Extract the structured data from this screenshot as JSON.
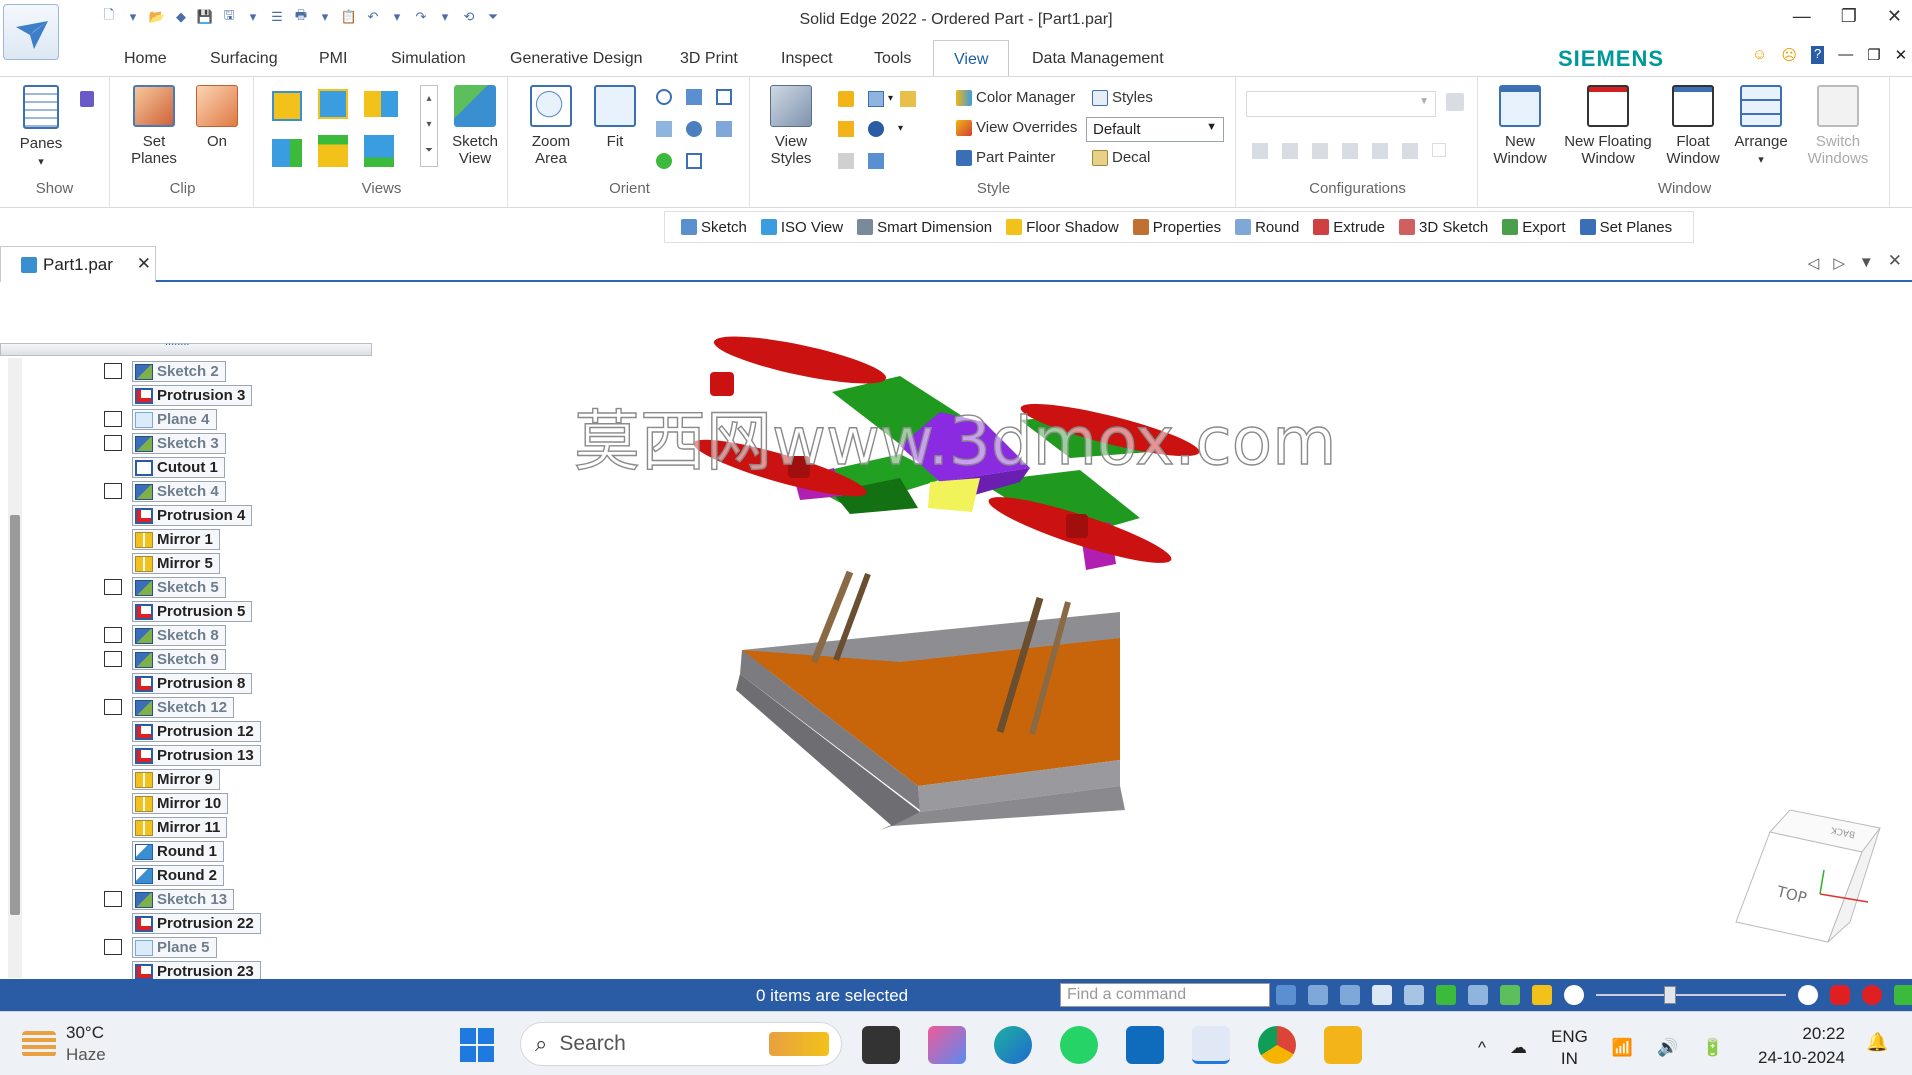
{
  "window": {
    "title": "Solid Edge 2022 - Ordered Part - [Part1.par]"
  },
  "tabs": [
    "Home",
    "Surfacing",
    "PMI",
    "Simulation",
    "Generative Design",
    "3D Print",
    "Inspect",
    "Tools",
    "View",
    "Data Management"
  ],
  "active_tab": "View",
  "brand": "SIEMENS",
  "ribbon": {
    "show": {
      "panes_label": "Panes",
      "group_label": "Show"
    },
    "clip": {
      "set_planes_label": "Set\nPlanes",
      "on_label": "On",
      "group_label": "Clip"
    },
    "views": {
      "sketch_view_label": "Sketch\nView",
      "group_label": "Views"
    },
    "orient": {
      "zoom_area_label": "Zoom\nArea",
      "fit_label": "Fit",
      "group_label": "Orient"
    },
    "style": {
      "view_styles_label": "View\nStyles",
      "color_manager": "Color Manager",
      "styles": "Styles",
      "view_overrides": "View Overrides",
      "overrides_value": "Default",
      "part_painter": "Part Painter",
      "decal": "Decal",
      "group_label": "Style"
    },
    "configurations": {
      "group_label": "Configurations"
    },
    "window": {
      "new_window": "New\nWindow",
      "new_floating_window": "New Floating\nWindow",
      "float_window": "Float\nWindow",
      "arrange": "Arrange",
      "switch_windows": "Switch\nWindows",
      "group_label": "Window"
    }
  },
  "command_bar": [
    "Sketch",
    "ISO View",
    "Smart Dimension",
    "Floor Shadow",
    "Properties",
    "Round",
    "Extrude",
    "3D Sketch",
    "Export",
    "Set Planes"
  ],
  "document_tab": {
    "label": "Part1.par"
  },
  "pathfinder": {
    "header_dots": "........",
    "items": [
      {
        "label": "Sketch 2",
        "type": "sketch",
        "check": true
      },
      {
        "label": "Protrusion 3",
        "type": "protrusion",
        "check": false
      },
      {
        "label": "Plane 4",
        "type": "plane",
        "check": true
      },
      {
        "label": "Sketch 3",
        "type": "sketch",
        "check": true
      },
      {
        "label": "Cutout 1",
        "type": "cutout",
        "check": false
      },
      {
        "label": "Sketch 4",
        "type": "sketch",
        "check": true
      },
      {
        "label": "Protrusion 4",
        "type": "protrusion",
        "check": false
      },
      {
        "label": "Mirror 1",
        "type": "mirror",
        "check": false
      },
      {
        "label": "Mirror 5",
        "type": "mirror",
        "check": false
      },
      {
        "label": "Sketch 5",
        "type": "sketch",
        "check": true
      },
      {
        "label": "Protrusion 5",
        "type": "protrusion",
        "check": false
      },
      {
        "label": "Sketch 8",
        "type": "sketch",
        "check": true
      },
      {
        "label": "Sketch 9",
        "type": "sketch",
        "check": true
      },
      {
        "label": "Protrusion 8",
        "type": "protrusion",
        "check": false
      },
      {
        "label": "Sketch 12",
        "type": "sketch",
        "check": true
      },
      {
        "label": "Protrusion 12",
        "type": "protrusion",
        "check": false
      },
      {
        "label": "Protrusion 13",
        "type": "protrusion",
        "check": false
      },
      {
        "label": "Mirror 9",
        "type": "mirror",
        "check": false
      },
      {
        "label": "Mirror 10",
        "type": "mirror",
        "check": false
      },
      {
        "label": "Mirror 11",
        "type": "mirror",
        "check": false
      },
      {
        "label": "Round 1",
        "type": "round",
        "check": false
      },
      {
        "label": "Round 2",
        "type": "round",
        "check": false
      },
      {
        "label": "Sketch 13",
        "type": "sketch",
        "check": true
      },
      {
        "label": "Protrusion 22",
        "type": "protrusion",
        "check": false
      },
      {
        "label": "Plane 5",
        "type": "plane",
        "check": true
      },
      {
        "label": "Protrusion 23",
        "type": "protrusion",
        "check": false
      }
    ]
  },
  "viewport": {
    "watermark": "莫西网www.3dmox.com",
    "view_cube_top": "TOP",
    "view_cube_back": "BACK"
  },
  "status": {
    "text": "0 items are selected",
    "find_placeholder": "Find a command"
  },
  "taskbar": {
    "weather_temp": "30°C",
    "weather_desc": "Haze",
    "search_label": "Search",
    "lang_1": "ENG",
    "lang_2": "IN",
    "time": "20:22",
    "date": "24-10-2024"
  },
  "colors": {
    "accent": "#2a5ca5",
    "siemens": "#009999",
    "propeller": "#cc1111",
    "arm": "#1f9a1f",
    "hub": "#8a2be2",
    "base": "#8e8e92",
    "tray": "#c8650a"
  }
}
